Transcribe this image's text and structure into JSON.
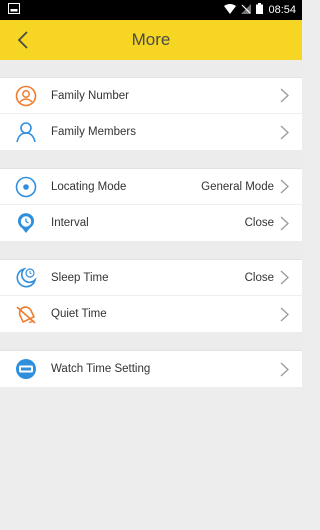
{
  "status_bar": {
    "time": "08:54"
  },
  "header": {
    "title": "More"
  },
  "groups": [
    {
      "items": [
        {
          "label": "Family Number",
          "icon": "phone-person-icon"
        },
        {
          "label": "Family Members",
          "icon": "person-outline-icon"
        }
      ]
    },
    {
      "items": [
        {
          "label": "Locating Mode",
          "value": "General Mode",
          "icon": "target-icon"
        },
        {
          "label": "Interval",
          "value": "Close",
          "icon": "clock-pin-icon"
        }
      ]
    },
    {
      "items": [
        {
          "label": "Sleep Time",
          "value": "Close",
          "icon": "moon-clock-icon"
        },
        {
          "label": "Quiet Time",
          "icon": "bell-mute-icon"
        }
      ]
    },
    {
      "items": [
        {
          "label": "Watch Time Setting",
          "icon": "watch-icon"
        }
      ]
    }
  ],
  "colors": {
    "header_bg": "#f6d623",
    "icon_blue": "#2f8fdd",
    "icon_orange": "#f07c2e",
    "chevron": "#9a9a9a"
  }
}
